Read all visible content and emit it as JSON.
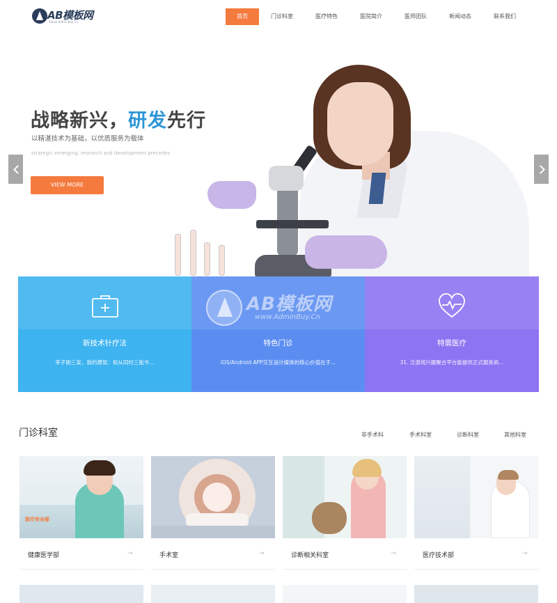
{
  "header": {
    "logo_text": "AB模板网",
    "logo_sub": "Xiaoai Admin Buy Co",
    "nav": [
      "首页",
      "门诊科室",
      "医疗特色",
      "医院简介",
      "医师团队",
      "新闻动态",
      "联系我们"
    ]
  },
  "hero": {
    "title_a": "战略新兴，",
    "title_b": "研发",
    "title_c": "先行",
    "subtitle": "以精湛技术为基础，以优质服务为载体",
    "en_text": "strategic emerging, research and development precedes",
    "button": "VIEW MORE"
  },
  "features": [
    {
      "title": "新技术针疗法",
      "desc": "李子刚三发，我的建筑：和从同时三能今...",
      "icon": "medical-kit-icon"
    },
    {
      "title": "特色门诊",
      "desc": "iOS/Android APP交互设计媒体的核心价值在于...",
      "icon": "none"
    },
    {
      "title": "特需医疗",
      "desc": "31. 泛游戏兴趣聚合平台能提供正式服务商...",
      "icon": "heart-pulse-icon"
    }
  ],
  "watermark": {
    "text": "AB模板网",
    "sub": "www.AdminBuy.Cn"
  },
  "departments": {
    "title": "门诊科室",
    "tabs": [
      "非手术科",
      "手术科室",
      "诊断科室",
      "其他科室"
    ],
    "cards": [
      {
        "name": "健康医学部",
        "badge": "医疗安全部"
      },
      {
        "name": "手术室"
      },
      {
        "name": "诊断相关科室"
      },
      {
        "name": "医疗技术部"
      }
    ],
    "arrow": "→"
  },
  "colors": {
    "accent": "#f47a3e",
    "feature_1": "#3db3f0",
    "feature_2": "#5b8df1",
    "feature_3": "#8d74f2",
    "highlight": "#2e96d8"
  }
}
